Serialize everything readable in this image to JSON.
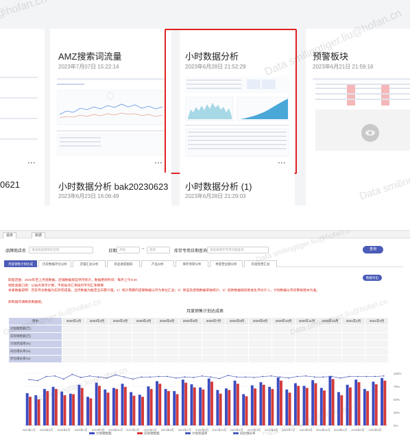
{
  "gallery": {
    "cards": [
      {
        "title": "AMZ搜索词流量",
        "time": "2023年7月07日 15:22:14"
      },
      {
        "title": "小时数据分析",
        "time": "2023年6月28日 21:52:29"
      },
      {
        "title": "预警板块",
        "time": "2023年6月21日 21:59:16"
      },
      {
        "title": "0621",
        "time": ""
      },
      {
        "title": "小时数据分析 bak20230623",
        "time": "2023年6月23日 16:06:49"
      },
      {
        "title": "小时数据分析 (1)",
        "time": "2023年6月28日 21:29:03"
      }
    ],
    "more_icon": "•••"
  },
  "watermarks": [
    "Data smilingtiger.liu@hofan.cn",
    "@hofan.cn",
    "Data smilingtigerliu@hofan.cn"
  ],
  "report": {
    "filters": {
      "store_label": "品牌商店名",
      "store_placeholder": "请选择品牌商店名称",
      "date_label": "日期",
      "date_start": "开始",
      "date_sep": "~",
      "date_end": "结束",
      "stock_label": "库存专用日期查询",
      "stock_placeholder": "请选择库存专用日期查询",
      "query_button": "查询"
    },
    "tabs": [
      "月度销售计划达成",
      "历史数据环比分析",
      "店铺汇总分析",
      "新品进度跟踪",
      "产品分析",
      "库存周转分析",
      "季度营业额分析",
      "年度经营汇总"
    ],
    "export_button": "数据导出",
    "notes": [
      "取值范围：2020年至上月底数据，店铺数据按自然月统计，数据更新时间：每月上午9:30",
      "销售金额口径：以站点货币计算，不同站点汇率按月平均汇率换算",
      "本表数据说明：历史月份数据为实际完成值，当月数据为截至当日累计值。1）统计周期内店铺数据以月为单位汇总；2）新品及促销数据单独统计；3）退款数据按退款发生月份计入，计划数据以年初审批版本为准。",
      "如有疑问请联系数据组。"
    ],
    "table_title": "月度销售计划达成表",
    "table_columns": [
      "月份",
      "2020年1月",
      "2020年2月",
      "2020年3月",
      "2020年4月",
      "2020年5月",
      "2020年6月",
      "2020年7月",
      "2020年8月",
      "2020年9月",
      "2020年10月",
      "2020年11月",
      "2020年12月",
      "2021年1月",
      "2021年2月"
    ],
    "table_rows": [
      "计划销售额(万)",
      "实际销售额(万)",
      "计划完成率(%)",
      "同比增长率(%)",
      "环比增长率(%)"
    ],
    "chart_legend": [
      "计划销售额",
      "实际销售额",
      "计划完成率",
      "同比增长率"
    ]
  },
  "chart_data": {
    "type": "bar",
    "title": "",
    "categories": [
      "2020年1月",
      "2020年2月",
      "2020年3月",
      "2020年4月",
      "2020年5月",
      "2020年6月",
      "2020年7月",
      "2020年8月",
      "2020年9月",
      "2020年10月",
      "2020年11月",
      "2020年12月",
      "2021年1月",
      "2021年2月",
      "2021年3月",
      "2021年4月",
      "2021年5月",
      "2021年6月",
      "2021年7月",
      "2021年8月",
      "2021年9月",
      "2021年10月",
      "2021年11月",
      "2021年12月",
      "2022年1月",
      "2022年2月",
      "2022年3月",
      "2022年4月",
      "2022年5月",
      "2022年6月",
      "2022年7月",
      "2022年8月",
      "2022年9月",
      "2022年10月",
      "2022年11月",
      "2022年12月",
      "2023年1月",
      "2023年2月",
      "2023年3月",
      "2023年4月",
      "2023年5月",
      "2023年6月"
    ],
    "series": [
      {
        "name": "计划销售额",
        "color": "#3b4cc0",
        "values": [
          62,
          58,
          70,
          74,
          65,
          61,
          78,
          55,
          82,
          69,
          72,
          80,
          64,
          59,
          75,
          85,
          70,
          66,
          88,
          79,
          73,
          90,
          68,
          71,
          86,
          60,
          77,
          83,
          74,
          92,
          69,
          81,
          76,
          87,
          72,
          95,
          64,
          78,
          88,
          70,
          84,
          91
        ]
      },
      {
        "name": "实际销售额",
        "color": "#d43a3a",
        "values": [
          55,
          50,
          66,
          70,
          58,
          60,
          72,
          52,
          76,
          63,
          70,
          74,
          57,
          55,
          70,
          80,
          66,
          60,
          82,
          73,
          69,
          84,
          61,
          68,
          80,
          56,
          71,
          78,
          70,
          86,
          63,
          76,
          72,
          81,
          67,
          89,
          58,
          73,
          83,
          66,
          79,
          86
        ]
      }
    ],
    "line_series": [
      {
        "name": "计划完成率",
        "color": "#4b5bb8",
        "values": [
          88,
          86,
          94,
          95,
          89,
          98,
          92,
          95,
          93,
          91,
          97,
          93,
          89,
          93,
          93,
          94,
          94,
          91,
          93,
          92,
          95,
          93,
          90,
          96,
          93,
          93,
          92,
          94,
          95,
          93,
          91,
          94,
          95,
          93,
          93,
          94,
          91,
          94,
          94,
          94,
          94,
          95
        ]
      }
    ],
    "ylim": [
      0,
      100
    ],
    "y2_ticks": [
      "100%",
      "75%",
      "50%",
      "25%",
      "0%"
    ],
    "grid": true
  }
}
